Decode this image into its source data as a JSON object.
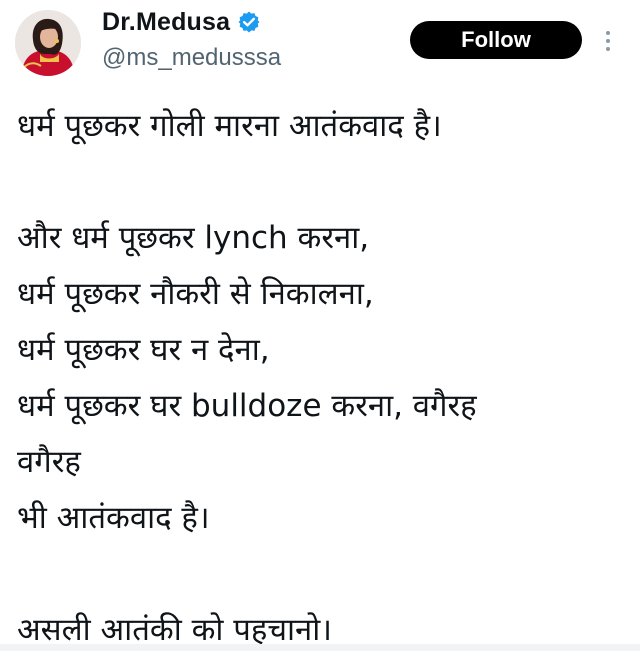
{
  "author": {
    "display_name": "Dr.Medusa",
    "handle": "@ms_medusssa",
    "verified": true,
    "verified_color": "#1d9bf0",
    "avatar_icon": "avatar-photo"
  },
  "actions": {
    "follow_label": "Follow",
    "follow_bg": "#000000",
    "more_icon": "vertical-ellipsis-icon"
  },
  "tweet": {
    "lines": [
      "धर्म पूछकर गोली मारना आतंकवाद है।",
      "",
      "और धर्म पूछकर lynch करना,",
      "धर्म पूछकर नौकरी से निकालना,",
      "धर्म पूछकर घर न देना,",
      "धर्म पूछकर घर bulldoze करना, वगैरह",
      "वगैरह",
      "भी आतंकवाद है।",
      "",
      "असली आतंकी को पहचानो।"
    ]
  }
}
